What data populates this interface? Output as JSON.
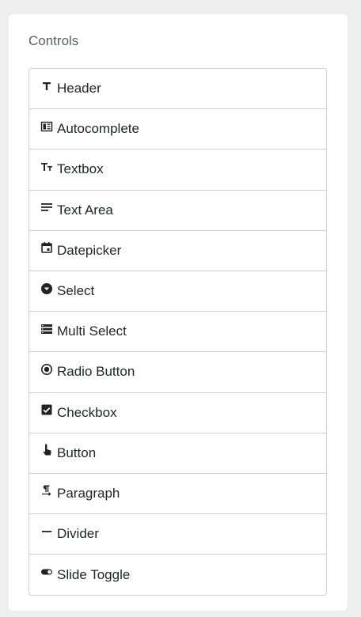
{
  "panel": {
    "title": "Controls"
  },
  "controls": [
    {
      "label": "Header",
      "icon": "header-icon"
    },
    {
      "label": "Autocomplete",
      "icon": "autocomplete-icon"
    },
    {
      "label": "Textbox",
      "icon": "textbox-icon"
    },
    {
      "label": "Text Area",
      "icon": "text-area-icon"
    },
    {
      "label": "Datepicker",
      "icon": "datepicker-icon"
    },
    {
      "label": "Select",
      "icon": "select-icon"
    },
    {
      "label": "Multi Select",
      "icon": "multi-select-icon"
    },
    {
      "label": "Radio Button",
      "icon": "radio-button-icon"
    },
    {
      "label": "Checkbox",
      "icon": "checkbox-icon"
    },
    {
      "label": "Button",
      "icon": "button-icon"
    },
    {
      "label": "Paragraph",
      "icon": "paragraph-icon"
    },
    {
      "label": "Divider",
      "icon": "divider-icon"
    },
    {
      "label": "Slide Toggle",
      "icon": "slide-toggle-icon"
    }
  ]
}
